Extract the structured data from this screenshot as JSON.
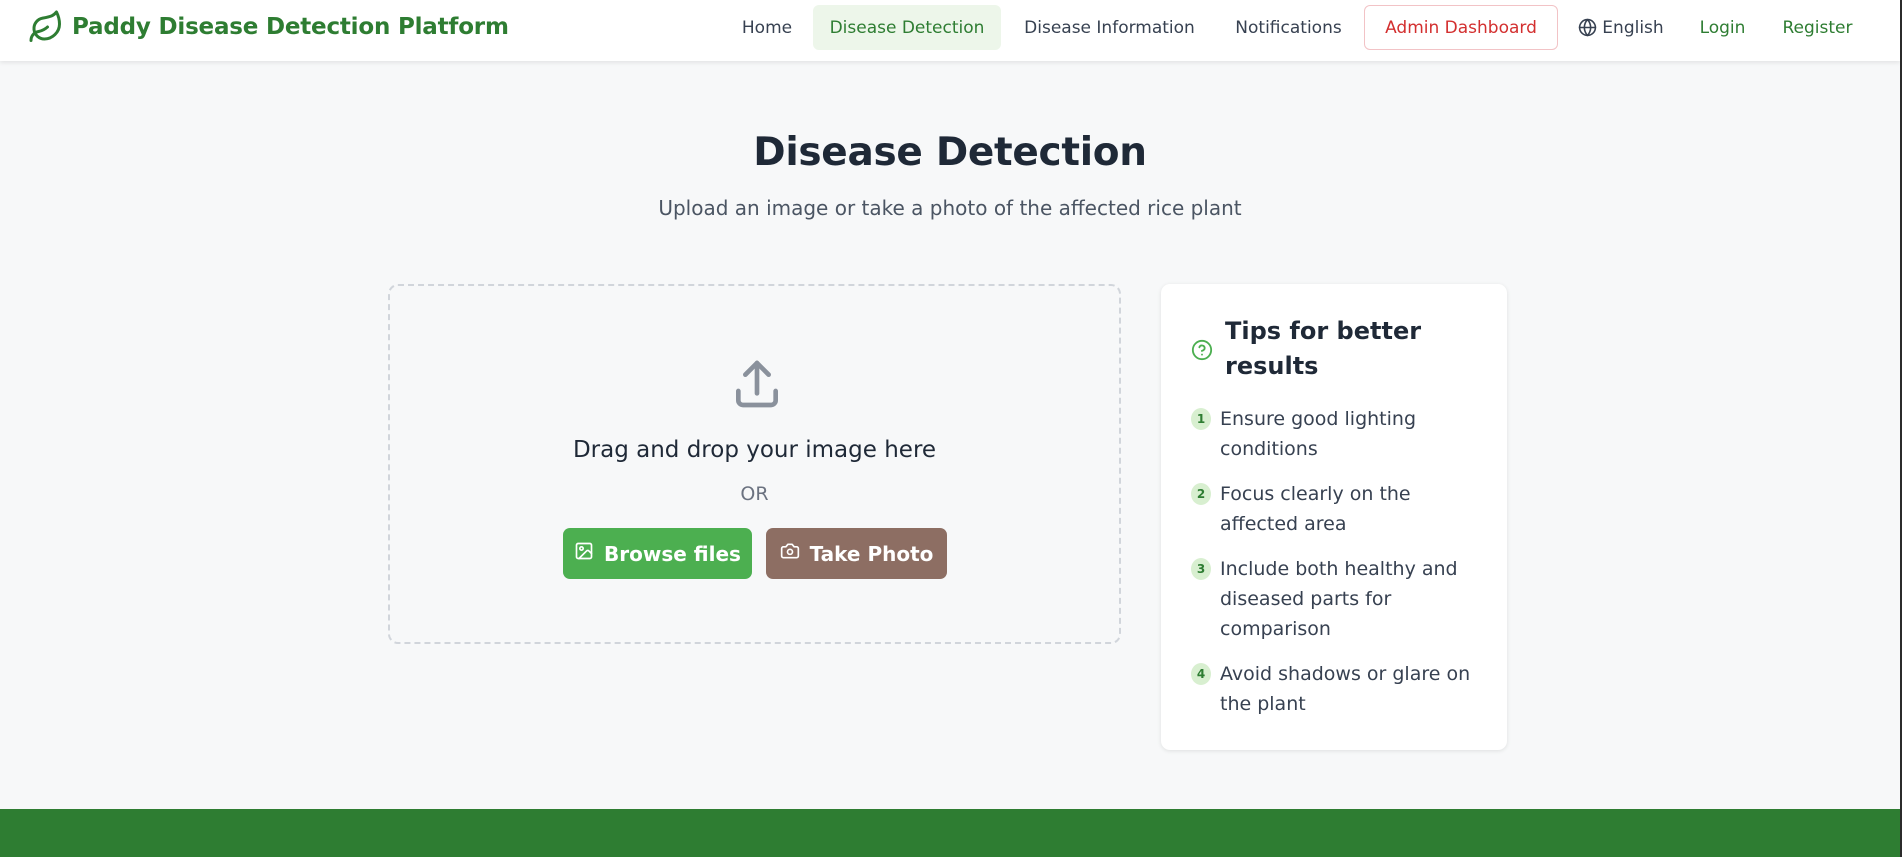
{
  "brand": {
    "name": "Paddy Disease Detection Platform",
    "icon": "leaf-icon"
  },
  "nav": {
    "home": "Home",
    "disease_detection": "Disease Detection",
    "disease_information": "Disease Information",
    "notifications": "Notifications",
    "admin_dashboard": "Admin Dashboard",
    "language": "English",
    "login": "Login",
    "register": "Register",
    "active_item": "Disease Detection"
  },
  "main": {
    "title": "Disease Detection",
    "subtitle": "Upload an image or take a photo of the affected rice plant"
  },
  "upload": {
    "icon": "upload-icon",
    "drop_text": "Drag and drop your image here",
    "or_text": "OR",
    "browse_label": "Browse files",
    "photo_label": "Take Photo"
  },
  "tips": {
    "title": "Tips for better results",
    "items": [
      {
        "num": "1",
        "text": "Ensure good lighting conditions"
      },
      {
        "num": "2",
        "text": "Focus clearly on the affected area"
      },
      {
        "num": "3",
        "text": "Include both healthy and diseased parts for comparison"
      },
      {
        "num": "4",
        "text": "Avoid shadows or glare on the plant"
      }
    ]
  },
  "colors": {
    "brand_green": "#2e7d32",
    "browse_green": "#4caf50",
    "photo_brown": "#8d6e63",
    "admin_red": "#d32f2f",
    "active_bg": "#edf6ea"
  }
}
